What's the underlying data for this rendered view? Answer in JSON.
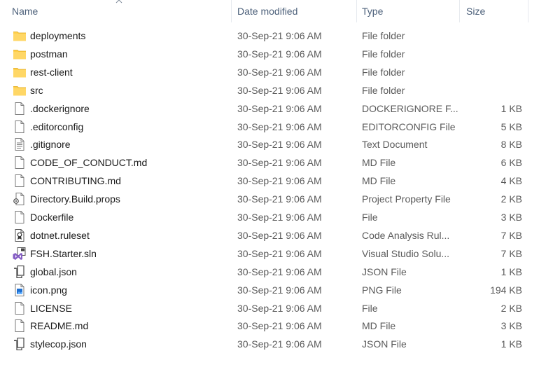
{
  "columns": {
    "name": "Name",
    "date_modified": "Date modified",
    "type": "Type",
    "size": "Size"
  },
  "sort": {
    "column": "name",
    "direction": "ascending"
  },
  "colors": {
    "header_text": "#4c607a",
    "folder": "#ffcf4a",
    "secondary_text": "#5a5a5a"
  },
  "files": [
    {
      "name": "deployments",
      "date": "30-Sep-21 9:06 AM",
      "type": "File folder",
      "size": "",
      "icon": "folder-icon"
    },
    {
      "name": "postman",
      "date": "30-Sep-21 9:06 AM",
      "type": "File folder",
      "size": "",
      "icon": "folder-icon"
    },
    {
      "name": "rest-client",
      "date": "30-Sep-21 9:06 AM",
      "type": "File folder",
      "size": "",
      "icon": "folder-icon"
    },
    {
      "name": "src",
      "date": "30-Sep-21 9:06 AM",
      "type": "File folder",
      "size": "",
      "icon": "folder-icon"
    },
    {
      "name": ".dockerignore",
      "date": "30-Sep-21 9:06 AM",
      "type": "DOCKERIGNORE F...",
      "size": "1 KB",
      "icon": "blank-file-icon"
    },
    {
      "name": ".editorconfig",
      "date": "30-Sep-21 9:06 AM",
      "type": "EDITORCONFIG File",
      "size": "5 KB",
      "icon": "blank-file-icon"
    },
    {
      "name": ".gitignore",
      "date": "30-Sep-21 9:06 AM",
      "type": "Text Document",
      "size": "8 KB",
      "icon": "text-file-icon"
    },
    {
      "name": "CODE_OF_CONDUCT.md",
      "date": "30-Sep-21 9:06 AM",
      "type": "MD File",
      "size": "6 KB",
      "icon": "blank-file-icon"
    },
    {
      "name": "CONTRIBUTING.md",
      "date": "30-Sep-21 9:06 AM",
      "type": "MD File",
      "size": "4 KB",
      "icon": "blank-file-icon"
    },
    {
      "name": "Directory.Build.props",
      "date": "30-Sep-21 9:06 AM",
      "type": "Project Property File",
      "size": "2 KB",
      "icon": "props-file-icon"
    },
    {
      "name": "Dockerfile",
      "date": "30-Sep-21 9:06 AM",
      "type": "File",
      "size": "3 KB",
      "icon": "blank-file-icon"
    },
    {
      "name": "dotnet.ruleset",
      "date": "30-Sep-21 9:06 AM",
      "type": "Code Analysis Rul...",
      "size": "7 KB",
      "icon": "ruleset-file-icon"
    },
    {
      "name": "FSH.Starter.sln",
      "date": "30-Sep-21 9:06 AM",
      "type": "Visual Studio Solu...",
      "size": "7 KB",
      "icon": "solution-file-icon"
    },
    {
      "name": "global.json",
      "date": "30-Sep-21 9:06 AM",
      "type": "JSON File",
      "size": "1 KB",
      "icon": "json-file-icon"
    },
    {
      "name": "icon.png",
      "date": "30-Sep-21 9:06 AM",
      "type": "PNG File",
      "size": "194 KB",
      "icon": "image-file-icon"
    },
    {
      "name": "LICENSE",
      "date": "30-Sep-21 9:06 AM",
      "type": "File",
      "size": "2 KB",
      "icon": "blank-file-icon"
    },
    {
      "name": "README.md",
      "date": "30-Sep-21 9:06 AM",
      "type": "MD File",
      "size": "3 KB",
      "icon": "blank-file-icon"
    },
    {
      "name": "stylecop.json",
      "date": "30-Sep-21 9:06 AM",
      "type": "JSON File",
      "size": "1 KB",
      "icon": "json-file-icon"
    }
  ]
}
